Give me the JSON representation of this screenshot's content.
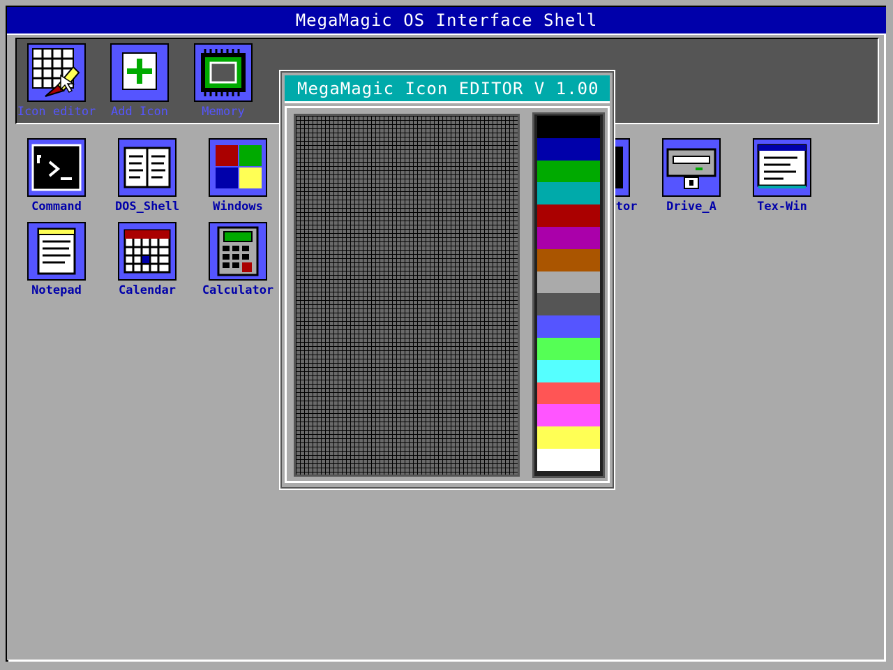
{
  "window": {
    "title": "MegaMagic OS Interface Shell"
  },
  "toolbar": {
    "items": [
      {
        "label": "Icon editor",
        "icon": "icon-editor-icon"
      },
      {
        "label": "Add Icon",
        "icon": "add-icon"
      },
      {
        "label": "Memory",
        "icon": "memory-chip-icon"
      }
    ]
  },
  "desktop": {
    "icons": [
      {
        "label": "Command",
        "icon": "command-prompt-icon"
      },
      {
        "label": "DOS_Shell",
        "icon": "dos-shell-icon"
      },
      {
        "label": "Windows",
        "icon": "windows-icon"
      },
      {
        "label": "ctor",
        "icon": "partially-hidden-icon"
      },
      {
        "label": "Drive_A",
        "icon": "floppy-drive-icon"
      },
      {
        "label": "Tex-Win",
        "icon": "text-window-icon"
      },
      {
        "label": "Notepad",
        "icon": "notepad-icon"
      },
      {
        "label": "Calendar",
        "icon": "calendar-icon"
      },
      {
        "label": "Calculator",
        "icon": "calculator-icon"
      }
    ]
  },
  "editor": {
    "title": "MegaMagic Icon EDITOR V 1.00",
    "palette": [
      "#000000",
      "#0000aa",
      "#00aa00",
      "#00aaaa",
      "#aa0000",
      "#aa00aa",
      "#aa5500",
      "#aaaaaa",
      "#555555",
      "#5555ff",
      "#55ff55",
      "#55ffff",
      "#ff5555",
      "#ff55ff",
      "#ffff55",
      "#ffffff"
    ]
  },
  "colors": {
    "titlebar": "#0000aa",
    "editor_titlebar": "#00aaaa",
    "desktop": "#aaaaaa",
    "icon_bg": "#5555ff"
  }
}
